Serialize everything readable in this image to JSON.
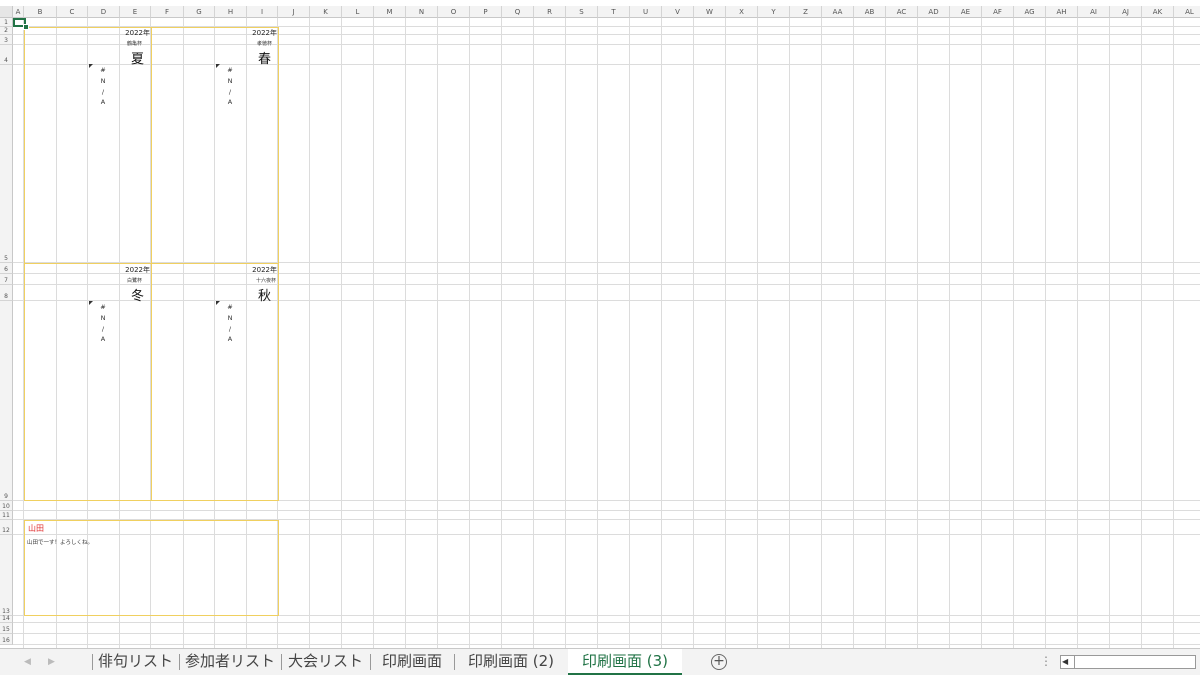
{
  "columns": [
    "A",
    "B",
    "C",
    "D",
    "E",
    "F",
    "G",
    "H",
    "I",
    "J",
    "K",
    "L",
    "M",
    "N",
    "O",
    "P",
    "Q",
    "R",
    "S",
    "T",
    "U",
    "V",
    "W",
    "X",
    "Y",
    "Z",
    "AA",
    "AB",
    "AC",
    "AD",
    "AE",
    "AF",
    "AG",
    "AH",
    "AI",
    "AJ",
    "AK",
    "AL"
  ],
  "rows": [
    "1",
    "2",
    "3",
    "4",
    "5",
    "6",
    "7",
    "8",
    "9",
    "10",
    "11",
    "12",
    "13",
    "14",
    "15",
    "16"
  ],
  "cards": [
    {
      "year": "2022年",
      "cup": "鶴亀杯",
      "season": "夏",
      "na": [
        "#",
        "N",
        "/",
        "A"
      ]
    },
    {
      "year": "2022年",
      "cup": "孝徳杯",
      "season": "春",
      "na": [
        "#",
        "N",
        "/",
        "A"
      ]
    },
    {
      "year": "2022年",
      "cup": "白鷺杯",
      "season": "冬",
      "na": [
        "#",
        "N",
        "/",
        "A"
      ]
    },
    {
      "year": "2022年",
      "cup": "十六夜杯",
      "season": "秋",
      "na": [
        "#",
        "N",
        "/",
        "A"
      ]
    }
  ],
  "profile": {
    "name": "山田",
    "message": "山田で一す！よろしくね。"
  },
  "tabs": [
    {
      "label": "俳句リスト",
      "active": false
    },
    {
      "label": "参加者リスト",
      "active": false
    },
    {
      "label": "大会リスト",
      "active": false
    },
    {
      "label": "印刷画面",
      "active": false
    },
    {
      "label": "印刷画面 (2)",
      "active": false
    },
    {
      "label": "印刷画面 (3)",
      "active": true
    }
  ],
  "icons": {
    "add_sheet": "plus-circle-icon",
    "prev_sheet": "chevron-left-icon",
    "next_sheet": "chevron-right-icon",
    "options": "vertical-dots-icon",
    "scroll_left": "scroll-left-icon"
  },
  "colors": {
    "accent": "#217346",
    "border_yellow": "#f0d060",
    "name_red": "#e03030"
  }
}
